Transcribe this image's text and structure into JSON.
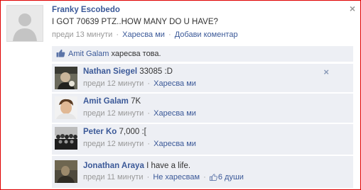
{
  "post": {
    "author": "Franky Escobedo",
    "text": "I GOT 70639 PTZ..HOW MANY DO U HAVE?",
    "time": "преди 13 минути",
    "like_label": "Харесва ми",
    "comment_label": "Добави коментар",
    "sep": "·",
    "close_symbol": "×"
  },
  "likes": {
    "name": "Amit Galam",
    "suffix": " харесва това."
  },
  "comments": [
    {
      "name": "Nathan Siegel",
      "text": "33085 :D",
      "time": "преди 12 минути",
      "action": "Харесва ми",
      "likes": ""
    },
    {
      "name": "Amit Galam",
      "text": "7K",
      "time": "преди 12 минути",
      "action": "Харесва ми",
      "likes": ""
    },
    {
      "name": "Peter Ko",
      "text": "7,000 :[",
      "time": "преди 12 минути",
      "action": "Харесва ми",
      "likes": ""
    },
    {
      "name": "Jonathan Araya",
      "text": "I have a life.",
      "time": "преди 11 минути",
      "action": "Не харесвам",
      "likes": "6 души"
    }
  ],
  "colors": {
    "link": "#3b5998",
    "comment_bg": "#edeff4",
    "border": "#e00000"
  }
}
